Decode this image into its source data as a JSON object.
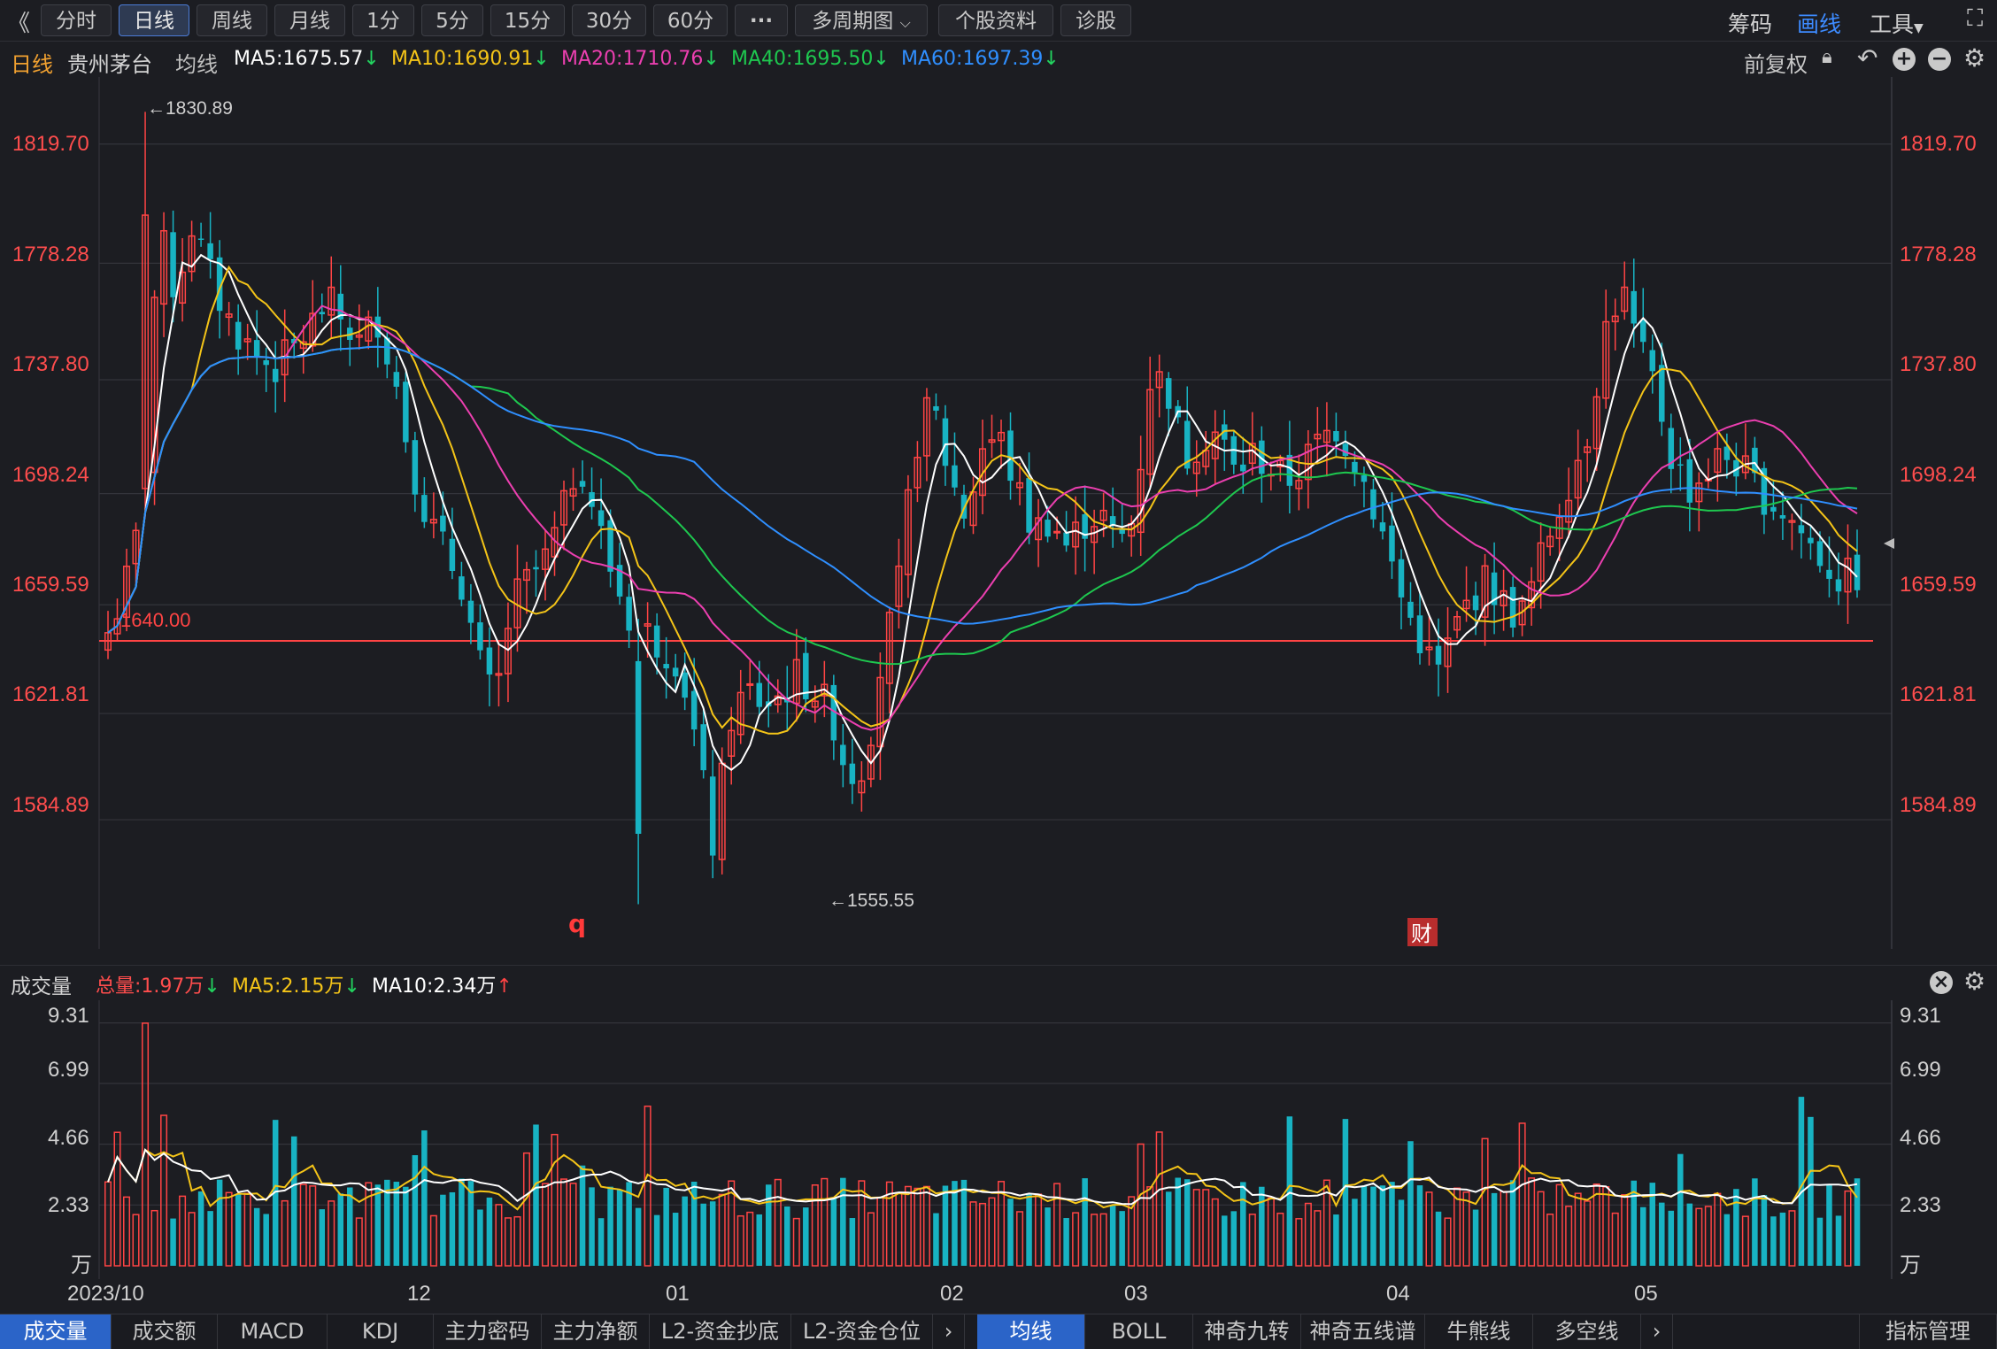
{
  "toolbar": {
    "back": "《",
    "buttons": [
      "分时",
      "日线",
      "周线",
      "月线",
      "1分",
      "5分",
      "15分",
      "30分",
      "60分",
      "···",
      "多周期图",
      "个股资料",
      "诊股"
    ],
    "right": [
      "筹码",
      "画线",
      "工具"
    ]
  },
  "infobar": {
    "period": "日线",
    "name": "贵州茅台",
    "ma_label": "均线",
    "ma5": "MA5:1675.57",
    "ma10": "MA10:1690.91",
    "ma20": "MA20:1710.76",
    "ma40": "MA40:1695.50",
    "ma60": "MA60:1697.39",
    "adj": "前复权"
  },
  "price_axis": [
    "1819.70",
    "1778.28",
    "1737.80",
    "1698.24",
    "1659.59",
    "1621.81",
    "1584.89"
  ],
  "annotations": {
    "high": "←1830.89",
    "low": "←1555.55",
    "hline": "1640.00",
    "marker_q": "q",
    "marker_cai": "财"
  },
  "volume_bar": {
    "title": "成交量",
    "total": "总量:1.97万",
    "ma5": "MA5:2.15万",
    "ma10": "MA10:2.34万"
  },
  "volume_axis": [
    "9.31",
    "6.99",
    "4.66",
    "2.33",
    "万"
  ],
  "x_labels": [
    "2023/10",
    "12",
    "01",
    "02",
    "03",
    "04",
    "05"
  ],
  "bottom_tabs_left": [
    "成交量",
    "成交额",
    "MACD",
    "KDJ",
    "主力密码",
    "主力净额",
    "L2-资金抄底",
    "L2-资金仓位"
  ],
  "bottom_tabs_right": [
    "均线",
    "BOLL",
    "神奇九转",
    "神奇五线谱",
    "牛熊线",
    "多空线"
  ],
  "bottom_right": "指标管理",
  "colors": {
    "up": "#ff4444",
    "down": "#18b3c3",
    "ma5": "#ffffff",
    "ma10": "#f4c418",
    "ma20": "#ec3fb0",
    "ma40": "#1ec84f",
    "ma60": "#2f8fff"
  },
  "chart_data": {
    "type": "candlestick",
    "count": 189,
    "price_range": [
      1540,
      1843
    ],
    "reference_price": 1640.0,
    "highest": 1830.89,
    "lowest": 1555.55,
    "volume_range": [
      0,
      9.5
    ],
    "volume_unit": "万"
  }
}
